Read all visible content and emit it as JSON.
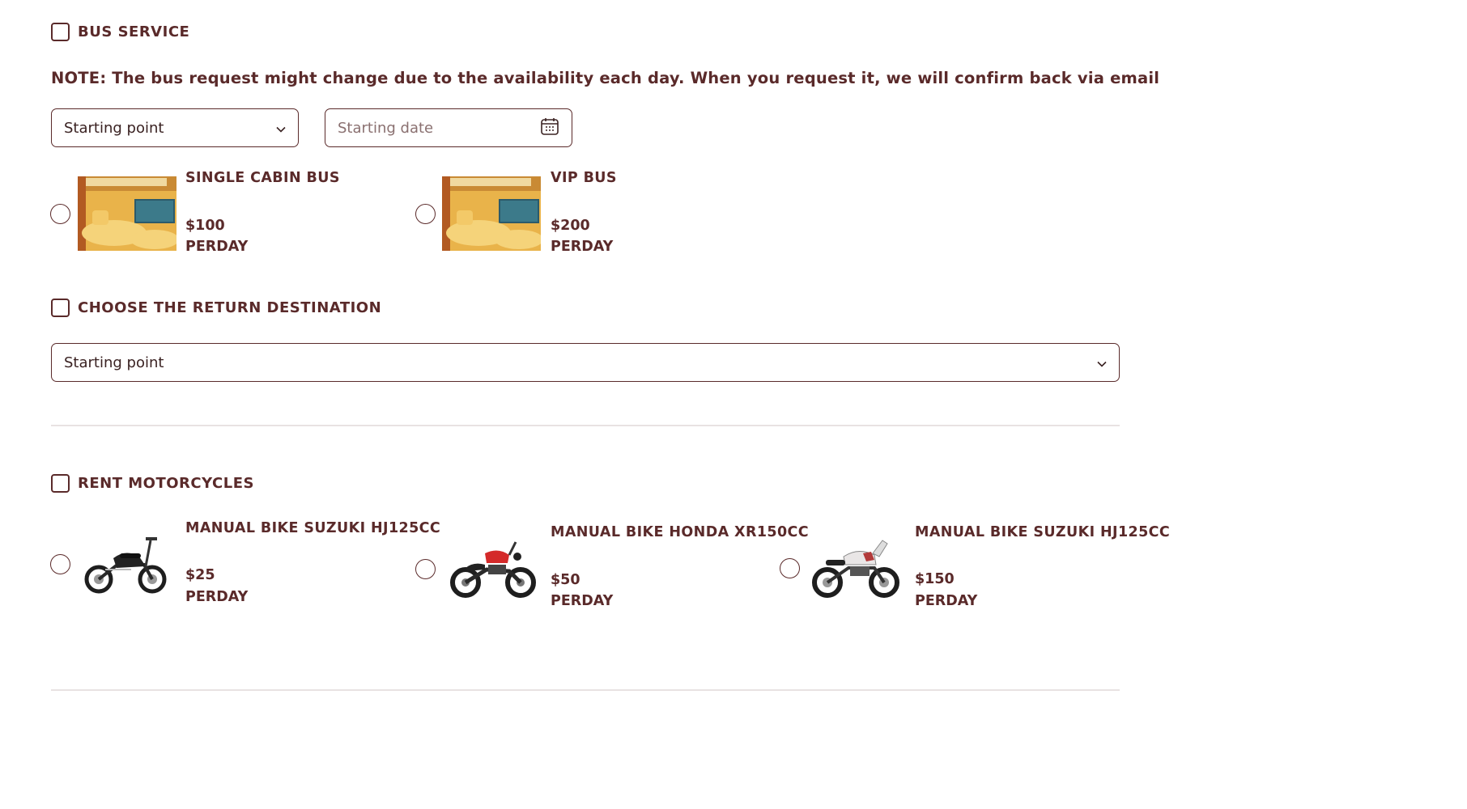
{
  "bus_service": {
    "label": "BUS SERVICE",
    "note": "NOTE: The bus request might change due to the availability each day. When you request it, we will confirm back via email",
    "starting_point": {
      "value": "Starting point"
    },
    "starting_date": {
      "placeholder": "Starting date"
    },
    "options": [
      {
        "title": "SINGLE CABIN BUS",
        "price": "$100",
        "unit": "PERDAY",
        "image": "bus-cabin-interior"
      },
      {
        "title": "VIP BUS",
        "price": "$200",
        "unit": "PERDAY",
        "image": "bus-cabin-interior"
      }
    ]
  },
  "return_destination": {
    "label": "CHOOSE THE RETURN DESTINATION",
    "starting_point": {
      "value": "Starting point"
    }
  },
  "motorcycles": {
    "label": "RENT MOTORCYCLES",
    "options": [
      {
        "title": "MANUAL BIKE SUZUKI HJ125CC",
        "price": "$25",
        "unit": "PERDAY",
        "image": "black-scooter"
      },
      {
        "title": "MANUAL BIKE HONDA XR150CC",
        "price": "$50",
        "unit": "PERDAY",
        "image": "red-cruiser"
      },
      {
        "title": "MANUAL BIKE SUZUKI HJ125CC",
        "price": "$150",
        "unit": "PERDAY",
        "image": "white-adventure-bike"
      }
    ]
  },
  "colors": {
    "accent": "#5a2a2a",
    "divider": "#e8e2e2",
    "background": "#ffffff"
  }
}
